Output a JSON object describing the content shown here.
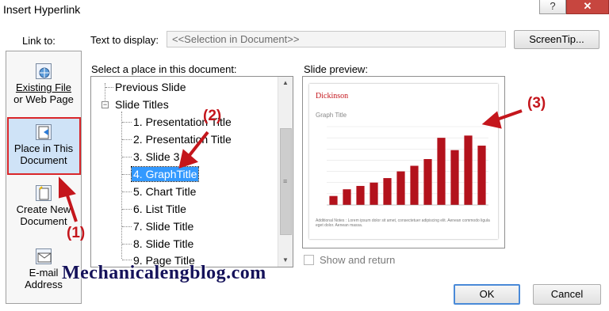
{
  "dialog": {
    "title": "Insert Hyperlink",
    "help": "?",
    "close": "✕"
  },
  "link_to": {
    "label": "Link to:",
    "items": [
      {
        "line1": "Existing File",
        "line2": "or Web Page",
        "icon": "web-page-icon"
      },
      {
        "line1": "Place in This",
        "line2": "Document",
        "icon": "place-in-document-icon",
        "selected": true
      },
      {
        "line1": "Create New",
        "line2": "Document",
        "icon": "new-document-icon"
      },
      {
        "line1": "E-mail",
        "line2": "Address",
        "icon": "email-icon"
      }
    ]
  },
  "text_to_display": {
    "label": "Text to display:",
    "value": "<<Selection in Document>>"
  },
  "screentip_button": "ScreenTip...",
  "tree": {
    "label": "Select a place in this document:",
    "items": [
      "Previous Slide",
      "Slide Titles",
      "1. Presentation Title",
      "2. Presentation Title",
      "3. Slide 3",
      "4. GraphTitle",
      "5. Chart Title",
      "6. List Title",
      "7. Slide Title",
      "8. Slide Title",
      "9. Page Title"
    ],
    "collapse_symbol": "−",
    "selected_index": 5
  },
  "preview": {
    "label": "Slide preview:",
    "slide_brand": "Dickinson",
    "slide_title": "Graph Title",
    "footnote": "Additional Notes : Lorem ipsum dolor sit amet, consectetuer adipiscing elit. Aenean commodo ligula eget dolor. Aenean massa."
  },
  "show_and_return": "Show and return",
  "ok_button": "OK",
  "cancel_button": "Cancel",
  "annotations": [
    "(1)",
    "(2)",
    "(3)"
  ],
  "watermark": "Mechanicalengblog.com",
  "colors": {
    "annotation": "#c4161c",
    "selection": "#3399ff",
    "bar": "#b3121c"
  },
  "chart_data": {
    "type": "bar",
    "title": "Graph Title",
    "values": [
      0.8,
      1.4,
      1.7,
      2.0,
      2.4,
      3.0,
      3.5,
      4.1,
      6.0,
      4.9,
      6.2,
      5.3
    ],
    "ylim": [
      0,
      7
    ]
  }
}
